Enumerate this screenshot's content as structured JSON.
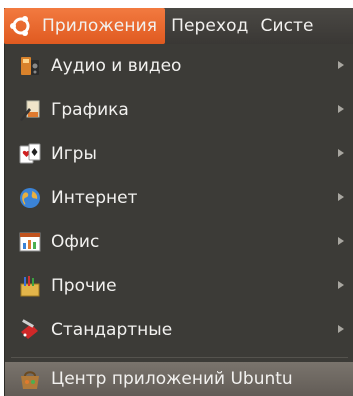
{
  "panel": {
    "menus": [
      {
        "label": "Приложения"
      },
      {
        "label": "Переход"
      },
      {
        "label": "Систе"
      }
    ]
  },
  "menu": {
    "items": [
      {
        "label": "Аудио и видео",
        "icon": "audio-video-icon",
        "submenu": true
      },
      {
        "label": "Графика",
        "icon": "graphics-icon",
        "submenu": true
      },
      {
        "label": "Игры",
        "icon": "games-icon",
        "submenu": true
      },
      {
        "label": "Интернет",
        "icon": "internet-globe-icon",
        "submenu": true
      },
      {
        "label": "Офис",
        "icon": "office-icon",
        "submenu": true
      },
      {
        "label": "Прочие",
        "icon": "other-icon",
        "submenu": true
      },
      {
        "label": "Стандартные",
        "icon": "accessories-icon",
        "submenu": true
      }
    ],
    "bottom_item": {
      "label": "Центр приложений Ubuntu",
      "icon": "software-center-icon"
    }
  },
  "colors": {
    "panel_bg": "#3f3d3a",
    "active_accent": "#e8642a",
    "menu_bg": "#3c3b37",
    "text": "#f2f1ef"
  }
}
